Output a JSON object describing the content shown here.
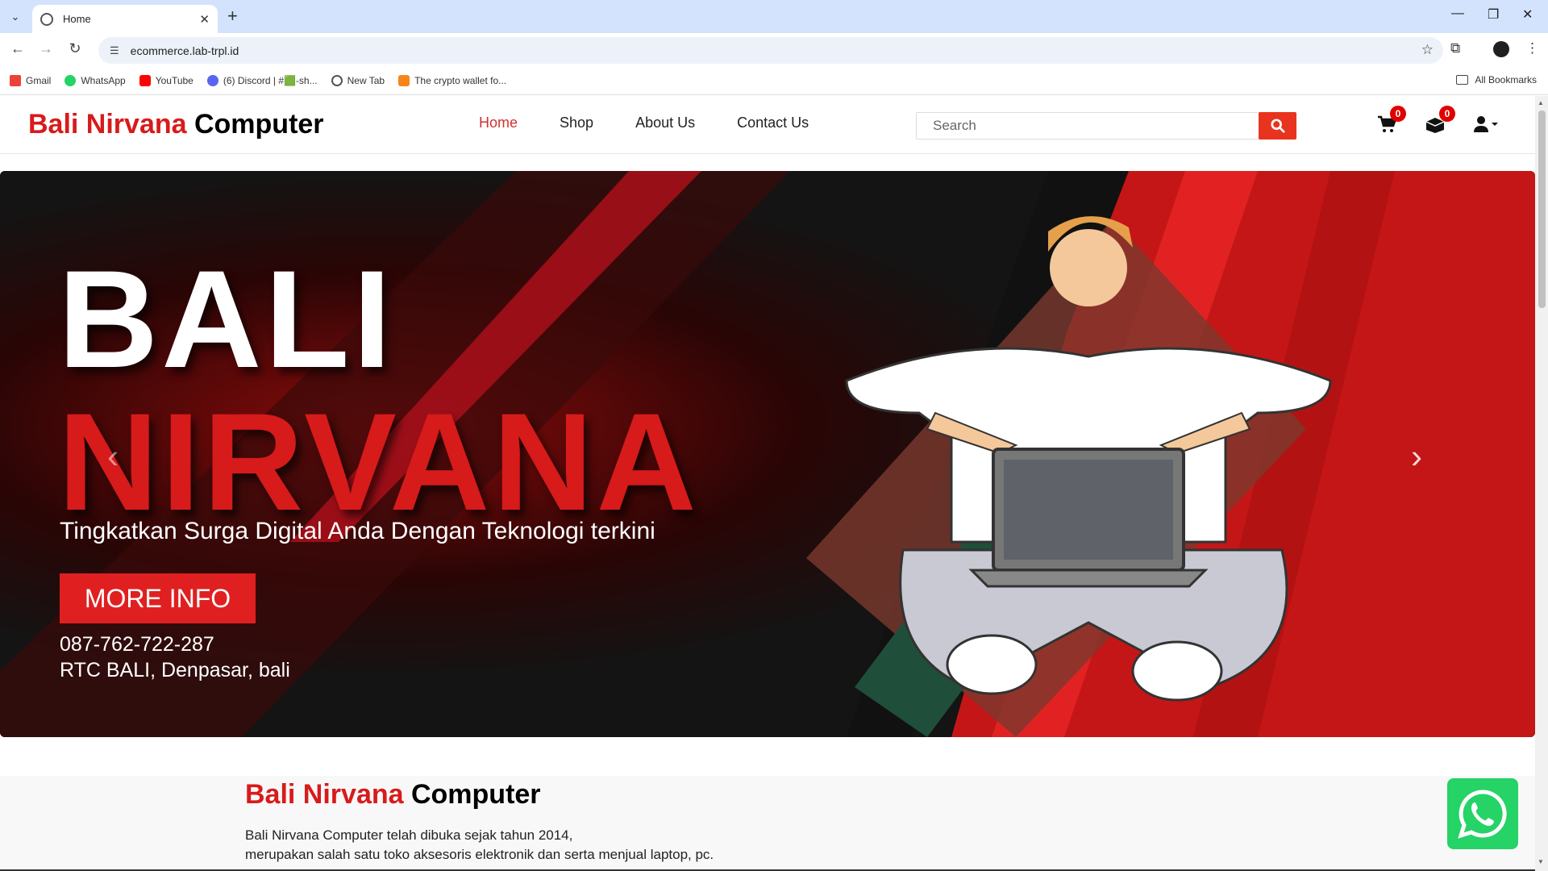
{
  "browser": {
    "tab_title": "Home",
    "url": "ecommerce.lab-trpl.id",
    "bookmarks": [
      "Gmail",
      "WhatsApp",
      "YouTube",
      "(6) Discord | #🟩-sh...",
      "New Tab",
      "The crypto wallet fo..."
    ],
    "all_bookmarks": "All Bookmarks"
  },
  "site": {
    "logo_part1": "Bali Nirvana",
    "logo_part2": "Computer",
    "nav": [
      "Home",
      "Shop",
      "About Us",
      "Contact Us"
    ],
    "search_placeholder": "Search",
    "cart_count": "0",
    "inbox_count": "0"
  },
  "hero": {
    "title_line1": "BALI",
    "title_line2": "NIRVANA",
    "subtitle": "Tingkatkan Surga Digital Anda Dengan Teknologi terkini",
    "button": "MORE INFO",
    "phone": "087-762-722-287",
    "address": "RTC BALI, Denpasar, bali"
  },
  "about": {
    "title_part1": "Bali Nirvana",
    "title_part2": "Computer",
    "line1": "Bali Nirvana Computer telah dibuka sejak tahun 2014,",
    "line2": "merupakan salah satu toko aksesoris elektronik dan serta menjual laptop, pc."
  },
  "colors": {
    "accent": "#d81b1b",
    "search_button": "#e8331f",
    "whatsapp": "#25d366"
  }
}
